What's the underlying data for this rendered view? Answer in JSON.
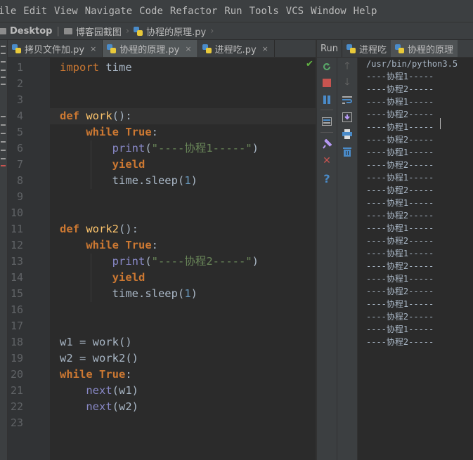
{
  "menu": [
    "ile",
    "Edit",
    "View",
    "Navigate",
    "Code",
    "Refactor",
    "Run",
    "Tools",
    "VCS",
    "Window",
    "Help"
  ],
  "breadcrumb": [
    "Desktop",
    "博客园截图",
    "协程的原理.py"
  ],
  "editor_tabs": [
    {
      "label": "拷贝文件加.py",
      "close": "×"
    },
    {
      "label": "协程的原理.py",
      "close": "×"
    },
    {
      "label": "进程吃.py",
      "close": "×"
    }
  ],
  "run_tabs": {
    "label": "Run",
    "tabs": [
      "进程吃",
      "协程的原理"
    ]
  },
  "code_lines": [
    {
      "n": "1",
      "parts": [
        [
          "kwn",
          "import"
        ],
        [
          "p",
          " time"
        ]
      ]
    },
    {
      "n": "2",
      "parts": []
    },
    {
      "n": "3",
      "parts": []
    },
    {
      "n": "4",
      "parts": [
        [
          "kw",
          "def"
        ],
        [
          "p",
          " "
        ],
        [
          "fn",
          "work"
        ],
        [
          "p",
          "():"
        ]
      ]
    },
    {
      "n": "5",
      "parts": [
        [
          "p",
          "    "
        ],
        [
          "kw",
          "while"
        ],
        [
          "p",
          " "
        ],
        [
          "kw",
          "True"
        ],
        [
          "p",
          ":"
        ]
      ]
    },
    {
      "n": "6",
      "parts": [
        [
          "p",
          "        "
        ],
        [
          "bi",
          "print"
        ],
        [
          "p",
          "("
        ],
        [
          "str",
          "\"----协程1-----\""
        ],
        [
          "p",
          ")"
        ]
      ]
    },
    {
      "n": "7",
      "parts": [
        [
          "p",
          "        "
        ],
        [
          "kw",
          "yield"
        ]
      ]
    },
    {
      "n": "8",
      "parts": [
        [
          "p",
          "        time.sleep("
        ],
        [
          "num",
          "1"
        ],
        [
          "p",
          ")"
        ]
      ]
    },
    {
      "n": "9",
      "parts": []
    },
    {
      "n": "10",
      "parts": []
    },
    {
      "n": "11",
      "parts": [
        [
          "kw",
          "def"
        ],
        [
          "p",
          " "
        ],
        [
          "fn",
          "work2"
        ],
        [
          "p",
          "():"
        ]
      ]
    },
    {
      "n": "12",
      "parts": [
        [
          "p",
          "    "
        ],
        [
          "kw",
          "while"
        ],
        [
          "p",
          " "
        ],
        [
          "kw",
          "True"
        ],
        [
          "p",
          ":"
        ]
      ]
    },
    {
      "n": "13",
      "parts": [
        [
          "p",
          "        "
        ],
        [
          "bi",
          "print"
        ],
        [
          "p",
          "("
        ],
        [
          "str",
          "\"----协程2-----\""
        ],
        [
          "p",
          ")"
        ]
      ]
    },
    {
      "n": "14",
      "parts": [
        [
          "p",
          "        "
        ],
        [
          "kw",
          "yield"
        ]
      ]
    },
    {
      "n": "15",
      "parts": [
        [
          "p",
          "        time.sleep("
        ],
        [
          "num",
          "1"
        ],
        [
          "p",
          ")"
        ]
      ]
    },
    {
      "n": "16",
      "parts": []
    },
    {
      "n": "17",
      "parts": []
    },
    {
      "n": "18",
      "parts": [
        [
          "p",
          "w1 = work()"
        ]
      ]
    },
    {
      "n": "19",
      "parts": [
        [
          "p",
          "w2 = work2()"
        ]
      ]
    },
    {
      "n": "20",
      "parts": [
        [
          "kw",
          "while"
        ],
        [
          "p",
          " "
        ],
        [
          "kw",
          "True"
        ],
        [
          "p",
          ":"
        ]
      ]
    },
    {
      "n": "21",
      "parts": [
        [
          "p",
          "    "
        ],
        [
          "bi",
          "next"
        ],
        [
          "p",
          "(w1)"
        ]
      ]
    },
    {
      "n": "22",
      "parts": [
        [
          "p",
          "    "
        ],
        [
          "bi",
          "next"
        ],
        [
          "p",
          "(w2)"
        ]
      ]
    },
    {
      "n": "23",
      "parts": []
    }
  ],
  "console_lines": [
    "/usr/bin/python3.5",
    "----协程1-----",
    "----协程2-----",
    "----协程1-----",
    "----协程2-----",
    "----协程1-----",
    "----协程2-----",
    "----协程1-----",
    "----协程2-----",
    "----协程1-----",
    "----协程2-----",
    "----协程1-----",
    "----协程2-----",
    "----协程1-----",
    "----协程2-----",
    "----协程1-----",
    "----协程2-----",
    "----协程1-----",
    "----协程2-----",
    "----协程1-----",
    "----协程2-----",
    "----协程1-----",
    "----协程2-----"
  ],
  "status": {
    "inspection": "✔"
  },
  "colors": {
    "keyword": "#cc7832",
    "function": "#ffc66d",
    "builtin": "#8888c6",
    "string": "#6a8759",
    "number": "#6897bb",
    "text": "#a9b7c6"
  },
  "toolbar_icons": [
    "rerun-icon",
    "stop-icon",
    "pause-icon",
    "layout-icon",
    "pin-icon",
    "close-icon",
    "help-icon",
    "up-arrow-icon",
    "down-arrow-icon",
    "wrap-icon",
    "scroll-end-icon",
    "print-icon",
    "trash-icon"
  ]
}
